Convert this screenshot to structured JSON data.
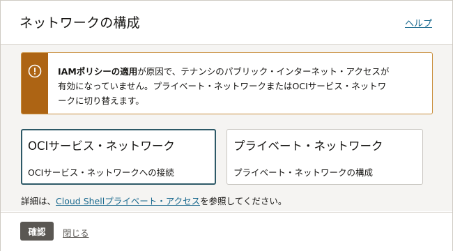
{
  "dialog": {
    "title": "ネットワークの構成",
    "help_label": "ヘルプ"
  },
  "warning": {
    "icon": "exclamation-circle-icon",
    "bold_text": "IAMポリシーの適用",
    "line1_rest": "が原因で、テナンシのパブリック・インターネット・アクセスが",
    "line2": "有効になっていません。プライベート・ネットワークまたはOCIサービス・ネットワ",
    "line3": "ークに切り替えます。",
    "colors": {
      "bar": "#ad6414",
      "border": "#c98e3c"
    }
  },
  "options": [
    {
      "title": "OCIサービス・ネットワーク",
      "description": "OCIサービス・ネットワークへの接続",
      "selected": true
    },
    {
      "title": "プライベート・ネットワーク",
      "description": "プライベート・ネットワークの構成",
      "selected": false
    }
  ],
  "details": {
    "prefix": "詳細は、",
    "link_label": "Cloud Shellプライベート・アクセス",
    "suffix": "を参照してください。"
  },
  "footer": {
    "confirm_label": "確認",
    "close_label": "閉じる"
  },
  "colors": {
    "link": "#1b6a8f",
    "primary_button": "#5a5753",
    "selected_border": "#2d5967",
    "body_background": "#f5f4f2"
  }
}
